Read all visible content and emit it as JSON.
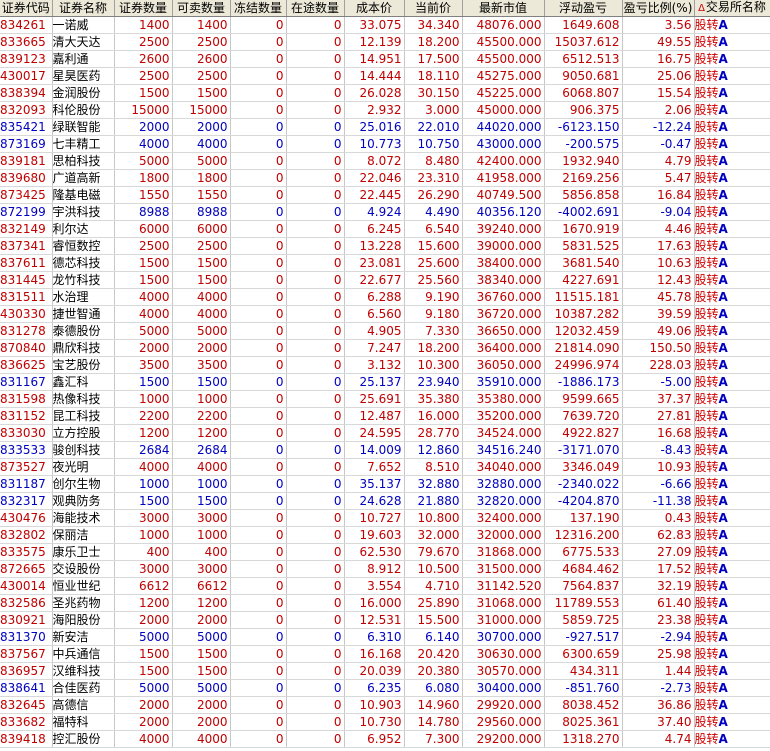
{
  "headers": [
    "证券代码",
    "证券名称",
    "证券数量",
    "可卖数量",
    "冻结数量",
    "在途数量",
    "成本价",
    "当前价",
    "最新市值",
    "浮动盈亏",
    "盈亏比例(%)",
    "交易所名称"
  ],
  "sort_indicator": "Δ",
  "market_tag": "A",
  "rows": [
    [
      "834261",
      "一诺威",
      "1400",
      "1400",
      "0",
      "0",
      "33.075",
      "34.340",
      "48076.000",
      "1649.608",
      "3.56",
      "股转"
    ],
    [
      "833665",
      "清大天达",
      "2500",
      "2500",
      "0",
      "0",
      "12.139",
      "18.200",
      "45500.000",
      "15037.612",
      "49.55",
      "股转"
    ],
    [
      "839123",
      "嘉利通",
      "2600",
      "2600",
      "0",
      "0",
      "14.951",
      "17.500",
      "45500.000",
      "6512.513",
      "16.75",
      "股转"
    ],
    [
      "430017",
      "星昊医药",
      "2500",
      "2500",
      "0",
      "0",
      "14.444",
      "18.110",
      "45275.000",
      "9050.681",
      "25.06",
      "股转"
    ],
    [
      "838394",
      "金润股份",
      "1500",
      "1500",
      "0",
      "0",
      "26.028",
      "30.150",
      "45225.000",
      "6068.807",
      "15.54",
      "股转"
    ],
    [
      "832093",
      "科伦股份",
      "15000",
      "15000",
      "0",
      "0",
      "2.932",
      "3.000",
      "45000.000",
      "906.375",
      "2.06",
      "股转"
    ],
    [
      "835421",
      "绿联智能",
      "2000",
      "2000",
      "0",
      "0",
      "25.016",
      "22.010",
      "44020.000",
      "-6123.150",
      "-12.24",
      "股转"
    ],
    [
      "873169",
      "七丰精工",
      "4000",
      "4000",
      "0",
      "0",
      "10.773",
      "10.750",
      "43000.000",
      "-200.575",
      "-0.47",
      "股转"
    ],
    [
      "839181",
      "思柏科技",
      "5000",
      "5000",
      "0",
      "0",
      "8.072",
      "8.480",
      "42400.000",
      "1932.940",
      "4.79",
      "股转"
    ],
    [
      "839680",
      "广道高新",
      "1800",
      "1800",
      "0",
      "0",
      "22.046",
      "23.310",
      "41958.000",
      "2169.256",
      "5.47",
      "股转"
    ],
    [
      "873425",
      "隆基电磁",
      "1550",
      "1550",
      "0",
      "0",
      "22.445",
      "26.290",
      "40749.500",
      "5856.858",
      "16.84",
      "股转"
    ],
    [
      "872199",
      "宇洪科技",
      "8988",
      "8988",
      "0",
      "0",
      "4.924",
      "4.490",
      "40356.120",
      "-4002.691",
      "-9.04",
      "股转"
    ],
    [
      "832149",
      "利尔达",
      "6000",
      "6000",
      "0",
      "0",
      "6.245",
      "6.540",
      "39240.000",
      "1670.919",
      "4.46",
      "股转"
    ],
    [
      "837341",
      "睿恒数控",
      "2500",
      "2500",
      "0",
      "0",
      "13.228",
      "15.600",
      "39000.000",
      "5831.525",
      "17.63",
      "股转"
    ],
    [
      "837611",
      "德芯科技",
      "1500",
      "1500",
      "0",
      "0",
      "23.081",
      "25.600",
      "38400.000",
      "3681.540",
      "10.63",
      "股转"
    ],
    [
      "831445",
      "龙竹科技",
      "1500",
      "1500",
      "0",
      "0",
      "22.677",
      "25.560",
      "38340.000",
      "4227.691",
      "12.43",
      "股转"
    ],
    [
      "831511",
      "水治理",
      "4000",
      "4000",
      "0",
      "0",
      "6.288",
      "9.190",
      "36760.000",
      "11515.181",
      "45.78",
      "股转"
    ],
    [
      "430330",
      "捷世智通",
      "4000",
      "4000",
      "0",
      "0",
      "6.560",
      "9.180",
      "36720.000",
      "10387.282",
      "39.59",
      "股转"
    ],
    [
      "831278",
      "泰德股份",
      "5000",
      "5000",
      "0",
      "0",
      "4.905",
      "7.330",
      "36650.000",
      "12032.459",
      "49.06",
      "股转"
    ],
    [
      "870840",
      "鼎欣科技",
      "2000",
      "2000",
      "0",
      "0",
      "7.247",
      "18.200",
      "36400.000",
      "21814.090",
      "150.50",
      "股转"
    ],
    [
      "836625",
      "宝艺股份",
      "3500",
      "3500",
      "0",
      "0",
      "3.132",
      "10.300",
      "36050.000",
      "24996.974",
      "228.03",
      "股转"
    ],
    [
      "831167",
      "鑫汇科",
      "1500",
      "1500",
      "0",
      "0",
      "25.137",
      "23.940",
      "35910.000",
      "-1886.173",
      "-5.00",
      "股转"
    ],
    [
      "831598",
      "热像科技",
      "1000",
      "1000",
      "0",
      "0",
      "25.691",
      "35.380",
      "35380.000",
      "9599.665",
      "37.37",
      "股转"
    ],
    [
      "831152",
      "昆工科技",
      "2200",
      "2200",
      "0",
      "0",
      "12.487",
      "16.000",
      "35200.000",
      "7639.720",
      "27.81",
      "股转"
    ],
    [
      "833030",
      "立方控股",
      "1200",
      "1200",
      "0",
      "0",
      "24.595",
      "28.770",
      "34524.000",
      "4922.827",
      "16.68",
      "股转"
    ],
    [
      "833533",
      "骏创科技",
      "2684",
      "2684",
      "0",
      "0",
      "14.009",
      "12.860",
      "34516.240",
      "-3171.070",
      "-8.43",
      "股转"
    ],
    [
      "873527",
      "夜光明",
      "4000",
      "4000",
      "0",
      "0",
      "7.652",
      "8.510",
      "34040.000",
      "3346.049",
      "10.93",
      "股转"
    ],
    [
      "831187",
      "创尔生物",
      "1000",
      "1000",
      "0",
      "0",
      "35.137",
      "32.880",
      "32880.000",
      "-2340.022",
      "-6.66",
      "股转"
    ],
    [
      "832317",
      "观典防务",
      "1500",
      "1500",
      "0",
      "0",
      "24.628",
      "21.880",
      "32820.000",
      "-4204.870",
      "-11.38",
      "股转"
    ],
    [
      "430476",
      "海能技术",
      "3000",
      "3000",
      "0",
      "0",
      "10.727",
      "10.800",
      "32400.000",
      "137.190",
      "0.43",
      "股转"
    ],
    [
      "832802",
      "保丽洁",
      "1000",
      "1000",
      "0",
      "0",
      "19.603",
      "32.000",
      "32000.000",
      "12316.200",
      "62.83",
      "股转"
    ],
    [
      "833575",
      "康乐卫士",
      "400",
      "400",
      "0",
      "0",
      "62.530",
      "79.670",
      "31868.000",
      "6775.533",
      "27.09",
      "股转"
    ],
    [
      "872665",
      "交设股份",
      "3000",
      "3000",
      "0",
      "0",
      "8.912",
      "10.500",
      "31500.000",
      "4684.462",
      "17.52",
      "股转"
    ],
    [
      "430014",
      "恒业世纪",
      "6612",
      "6612",
      "0",
      "0",
      "3.554",
      "4.710",
      "31142.520",
      "7564.837",
      "32.19",
      "股转"
    ],
    [
      "832586",
      "圣兆药物",
      "1200",
      "1200",
      "0",
      "0",
      "16.000",
      "25.890",
      "31068.000",
      "11789.553",
      "61.40",
      "股转"
    ],
    [
      "830921",
      "海阳股份",
      "2000",
      "2000",
      "0",
      "0",
      "12.531",
      "15.500",
      "31000.000",
      "5859.725",
      "23.38",
      "股转"
    ],
    [
      "831370",
      "新安洁",
      "5000",
      "5000",
      "0",
      "0",
      "6.310",
      "6.140",
      "30700.000",
      "-927.517",
      "-2.94",
      "股转"
    ],
    [
      "837567",
      "中兵通信",
      "1500",
      "1500",
      "0",
      "0",
      "16.168",
      "20.420",
      "30630.000",
      "6300.659",
      "25.98",
      "股转"
    ],
    [
      "836957",
      "汉维科技",
      "1500",
      "1500",
      "0",
      "0",
      "20.039",
      "20.380",
      "30570.000",
      "434.311",
      "1.44",
      "股转"
    ],
    [
      "838641",
      "合佳医药",
      "5000",
      "5000",
      "0",
      "0",
      "6.235",
      "6.080",
      "30400.000",
      "-851.760",
      "-2.73",
      "股转"
    ],
    [
      "832645",
      "高德信",
      "2000",
      "2000",
      "0",
      "0",
      "10.903",
      "14.960",
      "29920.000",
      "8038.452",
      "36.86",
      "股转"
    ],
    [
      "833682",
      "福特科",
      "2000",
      "2000",
      "0",
      "0",
      "10.730",
      "14.780",
      "29560.000",
      "8025.361",
      "37.40",
      "股转"
    ],
    [
      "839418",
      "控汇股份",
      "4000",
      "4000",
      "0",
      "0",
      "6.952",
      "7.300",
      "29200.000",
      "1318.270",
      "4.74",
      "股转"
    ]
  ]
}
